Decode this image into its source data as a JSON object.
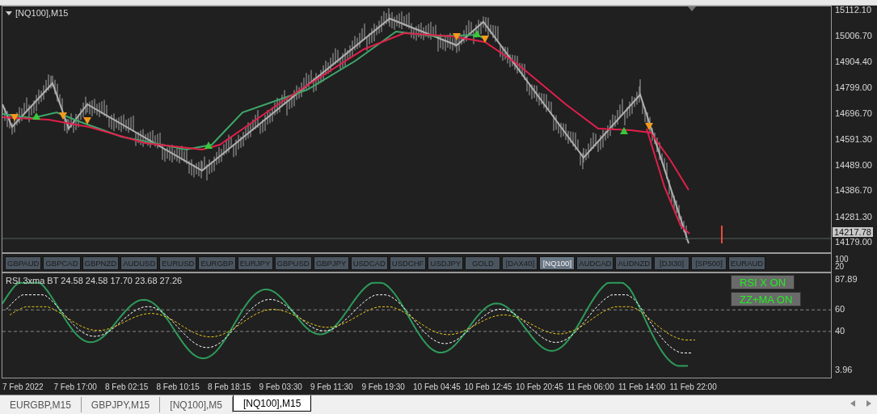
{
  "chart": {
    "title": "[NQ100],M15",
    "price_ticks": [
      "15112.10",
      "15006.70",
      "14904.40",
      "14799.00",
      "14696.70",
      "14591.30",
      "14489.00",
      "14386.70",
      "14281.30",
      "14179.00"
    ],
    "current_price": "14217.78"
  },
  "symbol_buttons": [
    {
      "label": "GBPAUD",
      "selected": false
    },
    {
      "label": "GBPCAD",
      "selected": false
    },
    {
      "label": "GBPNZD",
      "selected": false
    },
    {
      "label": "AUDUSD",
      "selected": false
    },
    {
      "label": "EURUSD",
      "selected": false
    },
    {
      "label": "EURGBP",
      "selected": false
    },
    {
      "label": "EURJPY",
      "selected": false
    },
    {
      "label": "GBPUSD",
      "selected": false
    },
    {
      "label": "GBPJPY",
      "selected": false
    },
    {
      "label": "USDCAD",
      "selected": false
    },
    {
      "label": "USDCHF",
      "selected": false
    },
    {
      "label": "USDJPY",
      "selected": false
    },
    {
      "label": "GOLD",
      "selected": false
    },
    {
      "label": "[DAX40]",
      "selected": false
    },
    {
      "label": "[NQ100]",
      "selected": true
    },
    {
      "label": "AUDCAD",
      "selected": false
    },
    {
      "label": "AUDNZD",
      "selected": false
    },
    {
      "label": "[DJI30]",
      "selected": false
    },
    {
      "label": "[SP500]",
      "selected": false
    },
    {
      "label": "EURAUD",
      "selected": false
    }
  ],
  "button_axis": [
    "100",
    "20"
  ],
  "rsi": {
    "title": "RSI 3xma BT 24.58 24.58 17.70 23.68 27.26",
    "ticks": [
      {
        "label": "87.89",
        "kind": "plain"
      },
      {
        "label": "60",
        "kind": "dashed"
      },
      {
        "label": "40",
        "kind": "dashed"
      },
      {
        "label": "3.96",
        "kind": "plain"
      }
    ],
    "toggles": [
      "RSI X ON",
      "ZZ+MA ON"
    ]
  },
  "time_axis": [
    "7 Feb 2022",
    "7 Feb 17:00",
    "8 Feb 02:15",
    "8 Feb 10:15",
    "8 Feb 18:15",
    "9 Feb 03:30",
    "9 Feb 11:30",
    "9 Feb 19:30",
    "10 Feb 04:45",
    "10 Feb 12:45",
    "10 Feb 20:45",
    "11 Feb 06:00",
    "11 Feb 14:00",
    "11 Feb 22:00"
  ],
  "tabs": [
    {
      "label": "EURGBP,M15",
      "selected": false
    },
    {
      "label": "GBPJPY,M15",
      "selected": false
    },
    {
      "label": "[NQ100],M5",
      "selected": false
    },
    {
      "label": "[NQ100],M15",
      "selected": true
    }
  ]
}
